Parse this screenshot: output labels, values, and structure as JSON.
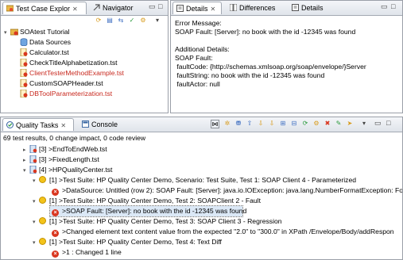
{
  "left_pane": {
    "tabs": [
      {
        "label": "Test Case Explor",
        "active": true
      },
      {
        "label": "Navigator",
        "active": false
      }
    ],
    "tree": [
      {
        "label": "SOAtest Tutorial",
        "red": false
      },
      {
        "label": "Data Sources",
        "red": false
      },
      {
        "label": "Calculator.tst",
        "red": false
      },
      {
        "label": "CheckTitleAlphabetization.tst",
        "red": false
      },
      {
        "label": "ClientTesterMethodExample.tst",
        "red": true
      },
      {
        "label": "CustomSOAPHeader.tst",
        "red": false
      },
      {
        "label": "DBToolParameterization.tst",
        "red": true
      }
    ]
  },
  "details_pane": {
    "tabs": [
      {
        "label": "Details",
        "active": true
      },
      {
        "label": "Differences",
        "active": false
      },
      {
        "label": "Details",
        "active": false
      }
    ],
    "lines": [
      "Error Message:",
      "SOAP Fault: [Server]: no book with the id -12345 was found",
      "",
      "Additional Details:",
      "SOAP Fault:",
      " faultCode: {http://schemas.xmlsoap.org/soap/envelope/}Server",
      " faultString: no book with the id -12345 was found",
      " faultActor: null"
    ]
  },
  "bottom_pane": {
    "tabs": [
      {
        "label": "Quality Tasks",
        "active": true
      },
      {
        "label": "Console",
        "active": false
      }
    ],
    "summary": "69 test results, 0 change impact, 0 code review",
    "rows": [
      {
        "icon": "file",
        "text": "[3] >EndToEndWeb.tst"
      },
      {
        "icon": "file",
        "text": "[3] >FixedLength.tst"
      },
      {
        "icon": "file",
        "text": "[4] >HPQualityCenter.tst"
      },
      {
        "icon": "warn",
        "text": "[1] >Test Suite: HP Quality Center Demo, Scenario: Test Suite, Test 1: SOAP Client 4 - Parameterized"
      },
      {
        "icon": "error",
        "text": ">DataSource: Untitled (row 2): SOAP Fault: [Server]: java.io.IOException: java.lang.NumberFormatException: Fo"
      },
      {
        "icon": "warn",
        "text": "[1] >Test Suite: HP Quality Center Demo, Test 2: SOAPClient 2 - Fault"
      },
      {
        "icon": "error",
        "text": ">SOAP Fault: [Server]: no book with the id -12345 was found",
        "selected": true
      },
      {
        "icon": "warn",
        "text": "[1] >Test Suite: HP Quality Center Demo, Test 3: SOAP Client 3 - Regression"
      },
      {
        "icon": "error",
        "text": ">Changed element text content value from the expected \"2.0\" to \"300.0\" in XPath /Envelope/Body/addRespon"
      },
      {
        "icon": "warn",
        "text": "[1] >Test Suite: HP Quality Center Demo, Test 4: Text Diff"
      },
      {
        "icon": "error",
        "text": ">1 : Changed 1 line"
      }
    ]
  }
}
